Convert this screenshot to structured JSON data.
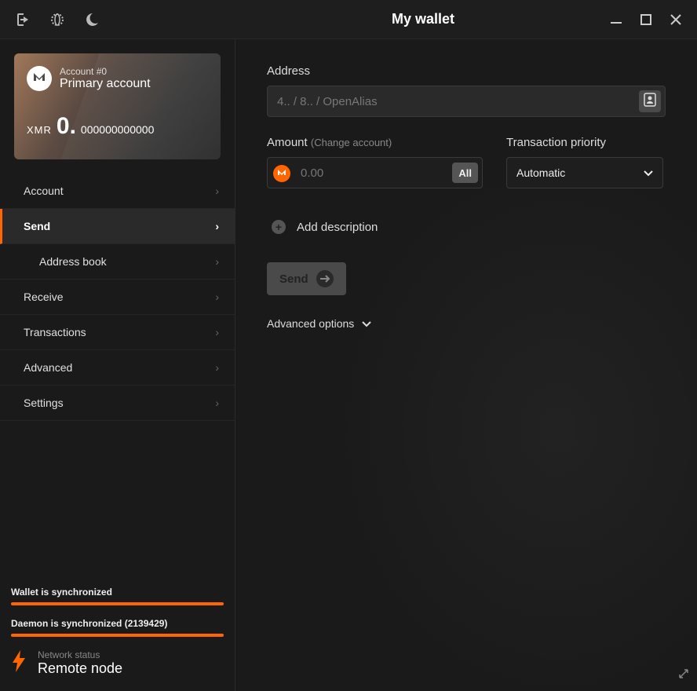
{
  "titlebar": {
    "title": "My wallet"
  },
  "account_card": {
    "account_number": "Account #0",
    "account_name": "Primary account",
    "currency": "XMR",
    "balance_int": "0.",
    "balance_dec": "000000000000"
  },
  "nav": {
    "account": "Account",
    "send": "Send",
    "address_book": "Address book",
    "receive": "Receive",
    "transactions": "Transactions",
    "advanced": "Advanced",
    "settings": "Settings"
  },
  "sync": {
    "wallet_label": "Wallet is synchronized",
    "daemon_label": "Daemon is synchronized (2139429)"
  },
  "network": {
    "status_label": "Network status",
    "status_value": "Remote node"
  },
  "send_form": {
    "address_label": "Address",
    "address_placeholder": "4.. / 8.. / OpenAlias",
    "amount_label": "Amount",
    "amount_hint": "(Change account)",
    "amount_placeholder": "0.00",
    "all_button": "All",
    "priority_label": "Transaction priority",
    "priority_value": "Automatic",
    "add_description": "Add description",
    "send_button": "Send",
    "advanced_options": "Advanced options"
  },
  "colors": {
    "accent": "#ff6600"
  }
}
